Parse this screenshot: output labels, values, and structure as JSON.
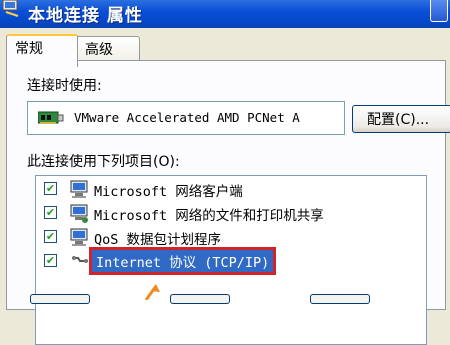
{
  "window": {
    "title": "本地连接 属性",
    "title_icon": "network-connection-icon",
    "close_icon": "close-icon"
  },
  "tabs": [
    {
      "label": "常规",
      "active": true
    },
    {
      "label": "高级",
      "active": false
    }
  ],
  "general": {
    "connect_using_label": "连接时使用:",
    "adapter": {
      "icon": "network-card-icon",
      "name": "VMware Accelerated AMD PCNet A"
    },
    "configure_button": "配置(C)...",
    "items_label": "此连接使用下列项目(O):",
    "items": [
      {
        "label": "Microsoft 网络客户端",
        "checked": true,
        "icon": "network-client-icon"
      },
      {
        "label": "Microsoft 网络的文件和打印机共享",
        "checked": true,
        "icon": "file-printer-sharing-icon"
      },
      {
        "label": "QoS 数据包计划程序",
        "checked": true,
        "icon": "qos-scheduler-icon"
      },
      {
        "label": "Internet 协议 (TCP/IP)",
        "checked": true,
        "icon": "network-protocol-icon",
        "selected": true
      }
    ]
  },
  "colors": {
    "titlebar": "#0a4fd6",
    "selection": "#316ac5",
    "highlight_border": "#d0242b",
    "callout_arrow": "#f08a24"
  }
}
